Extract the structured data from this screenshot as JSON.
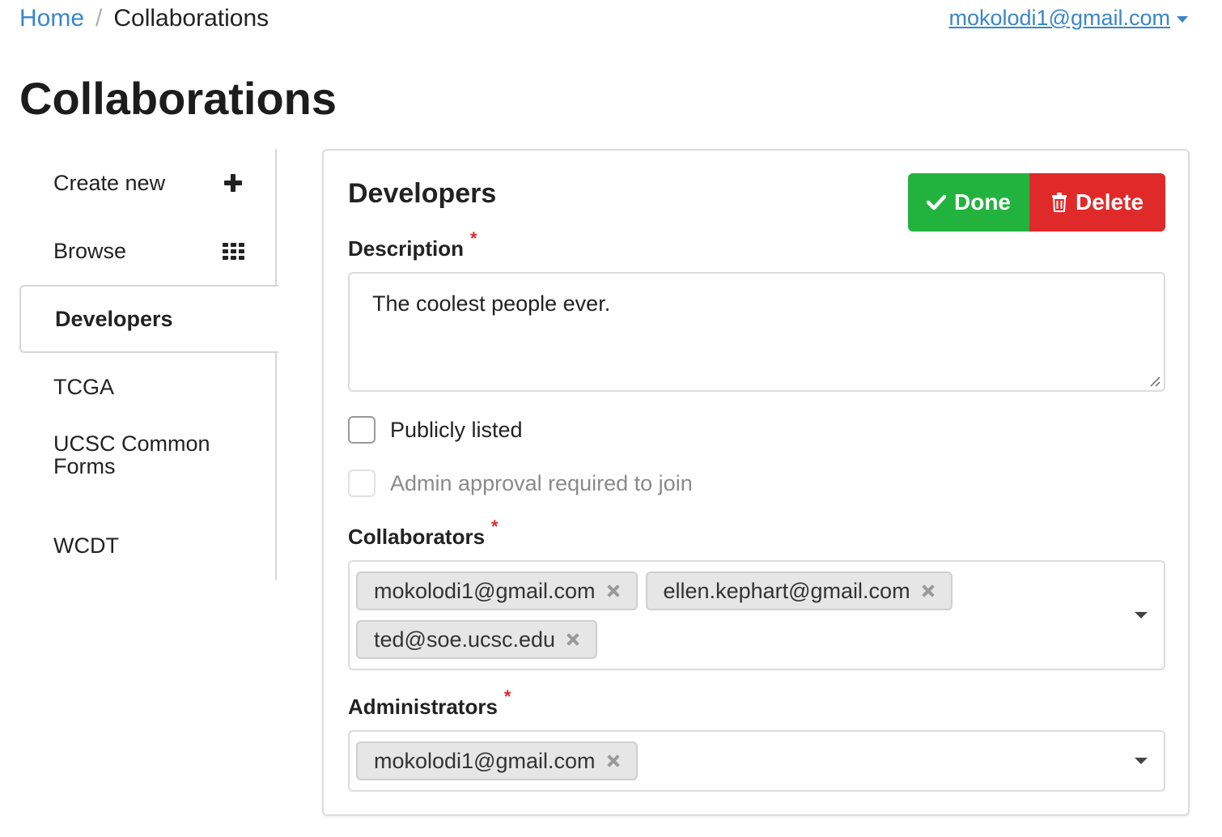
{
  "breadcrumb": {
    "home": "Home",
    "separator": "/",
    "current": "Collaborations"
  },
  "user_menu": {
    "email": "mokolodi1@gmail.com",
    "icon": "caret-down-icon"
  },
  "page_title": "Collaborations",
  "sidebar": {
    "items": [
      {
        "label": "Create new",
        "icon": "plus-icon"
      },
      {
        "label": "Browse",
        "icon": "grid-icon"
      },
      {
        "label": "Developers",
        "active": true
      },
      {
        "label": "TCGA"
      },
      {
        "label": "UCSC Common Forms"
      },
      {
        "label": "WCDT"
      }
    ]
  },
  "panel": {
    "title": "Developers",
    "done_label": "Done",
    "delete_label": "Delete",
    "description_label": "Description",
    "required_marker": "*",
    "description_value": "The coolest people ever.",
    "publicly_listed_label": "Publicly listed",
    "publicly_listed_checked": false,
    "admin_approval_label": "Admin approval required to join",
    "admin_approval_checked": false,
    "admin_approval_disabled": true,
    "collaborators_label": "Collaborators",
    "collaborators": [
      "mokolodi1@gmail.com",
      "ellen.kephart@gmail.com",
      "ted@soe.ucsc.edu"
    ],
    "administrators_label": "Administrators",
    "administrators": [
      "mokolodi1@gmail.com"
    ]
  },
  "colors": {
    "link": "#3a86c8",
    "done": "#22b33f",
    "delete": "#e02a2a",
    "required": "#d62d2d"
  }
}
